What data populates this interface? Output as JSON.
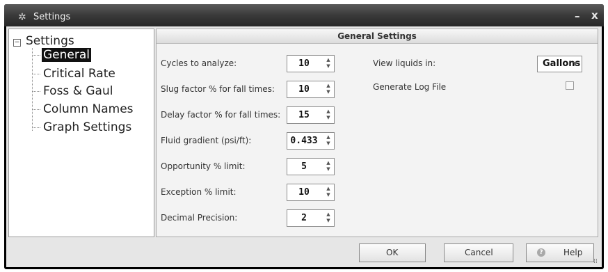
{
  "window": {
    "title": "Settings",
    "minimize_glyph": "–",
    "close_glyph": "x"
  },
  "tree": {
    "root_label": "Settings",
    "items": [
      {
        "label": "General",
        "selected": true
      },
      {
        "label": "Critical Rate",
        "selected": false
      },
      {
        "label": "Foss & Gaul",
        "selected": false
      },
      {
        "label": "Column Names",
        "selected": false
      },
      {
        "label": "Graph Settings",
        "selected": false
      }
    ]
  },
  "panel": {
    "title": "General Settings",
    "fields": [
      {
        "label": "Cycles to analyze:",
        "value": "10"
      },
      {
        "label": "Slug factor % for fall times:",
        "value": "10"
      },
      {
        "label": "Delay factor % for fall times:",
        "value": "15"
      },
      {
        "label": "Fluid gradient (psi/ft):",
        "value": "0.433"
      },
      {
        "label": "Opportunity % limit:",
        "value": "5"
      },
      {
        "label": "Exception % limit:",
        "value": "10"
      },
      {
        "label": "Decimal Precision:",
        "value": "2"
      }
    ],
    "view_liquids": {
      "label": "View liquids in:",
      "value": "Gallons"
    },
    "log_file": {
      "label": "Generate Log File",
      "checked": false
    }
  },
  "buttons": {
    "ok": "OK",
    "cancel": "Cancel",
    "help": "Help"
  },
  "icons": [
    "gear-icon",
    "minimize-icon",
    "close-icon",
    "collapse-icon",
    "help-icon",
    "spin-arrows-icon",
    "dropdown-arrow-icon",
    "resize-grip-icon"
  ],
  "colors": {
    "titlebar": "#3a3a3a",
    "client_bg": "#e6e6e6",
    "selection": "#111111",
    "panel_bg": "#f3f3f3"
  }
}
